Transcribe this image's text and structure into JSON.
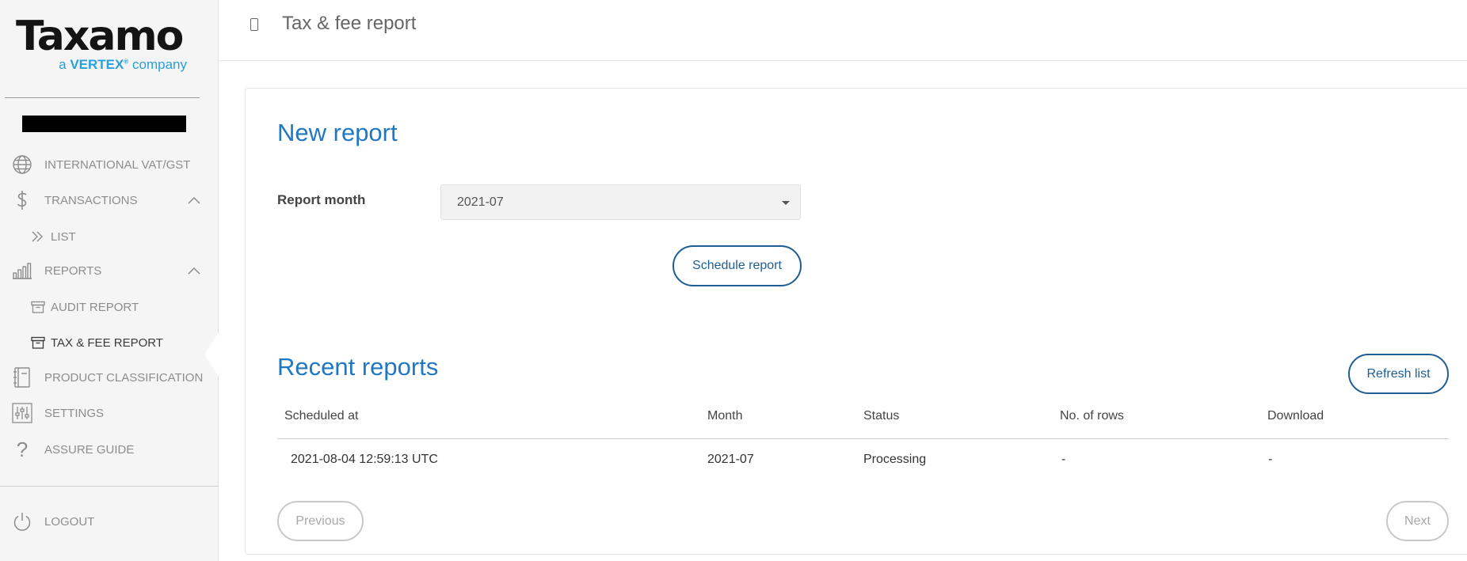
{
  "brand": {
    "name": "Taxamo",
    "tagline_prefix": "a",
    "tagline_brand": "VERTEX",
    "tagline_mark": "®",
    "tagline_suffix": "company",
    "accent_color": "#27a0dc"
  },
  "sidebar": {
    "items": [
      {
        "label": "INTERNATIONAL VAT/GST",
        "icon": "globe-icon"
      },
      {
        "label": "TRANSACTIONS",
        "icon": "dollar-icon",
        "expanded": true
      },
      {
        "label": "LIST",
        "icon": "double-chevron-right-icon",
        "sub": true
      },
      {
        "label": "REPORTS",
        "icon": "bar-chart-icon",
        "expanded": true
      },
      {
        "label": "AUDIT REPORT",
        "icon": "archive-box-icon",
        "sub": true
      },
      {
        "label": "TAX & FEE REPORT",
        "icon": "archive-box-icon",
        "sub": true,
        "active": true
      },
      {
        "label": "PRODUCT CLASSIFICATION",
        "icon": "book-icon"
      },
      {
        "label": "SETTINGS",
        "icon": "sliders-icon"
      },
      {
        "label": "ASSURE GUIDE",
        "icon": "question-icon"
      }
    ],
    "logout": {
      "label": "LOGOUT",
      "icon": "power-icon"
    }
  },
  "header": {
    "title": "Tax & fee report"
  },
  "new_report": {
    "heading": "New report",
    "month_label": "Report month",
    "month_value": "2021-07",
    "schedule_button": "Schedule report"
  },
  "recent_reports": {
    "heading": "Recent reports",
    "refresh_button": "Refresh list",
    "columns": [
      "Scheduled at",
      "Month",
      "Status",
      "No. of rows",
      "Download"
    ],
    "rows": [
      [
        "2021-08-04 12:59:13 UTC",
        "2021-07",
        "Processing",
        "-",
        "-"
      ]
    ],
    "previous_button": "Previous",
    "next_button": "Next"
  },
  "colors": {
    "heading_blue": "#1f78c1",
    "button_blue": "#1e5e93"
  }
}
